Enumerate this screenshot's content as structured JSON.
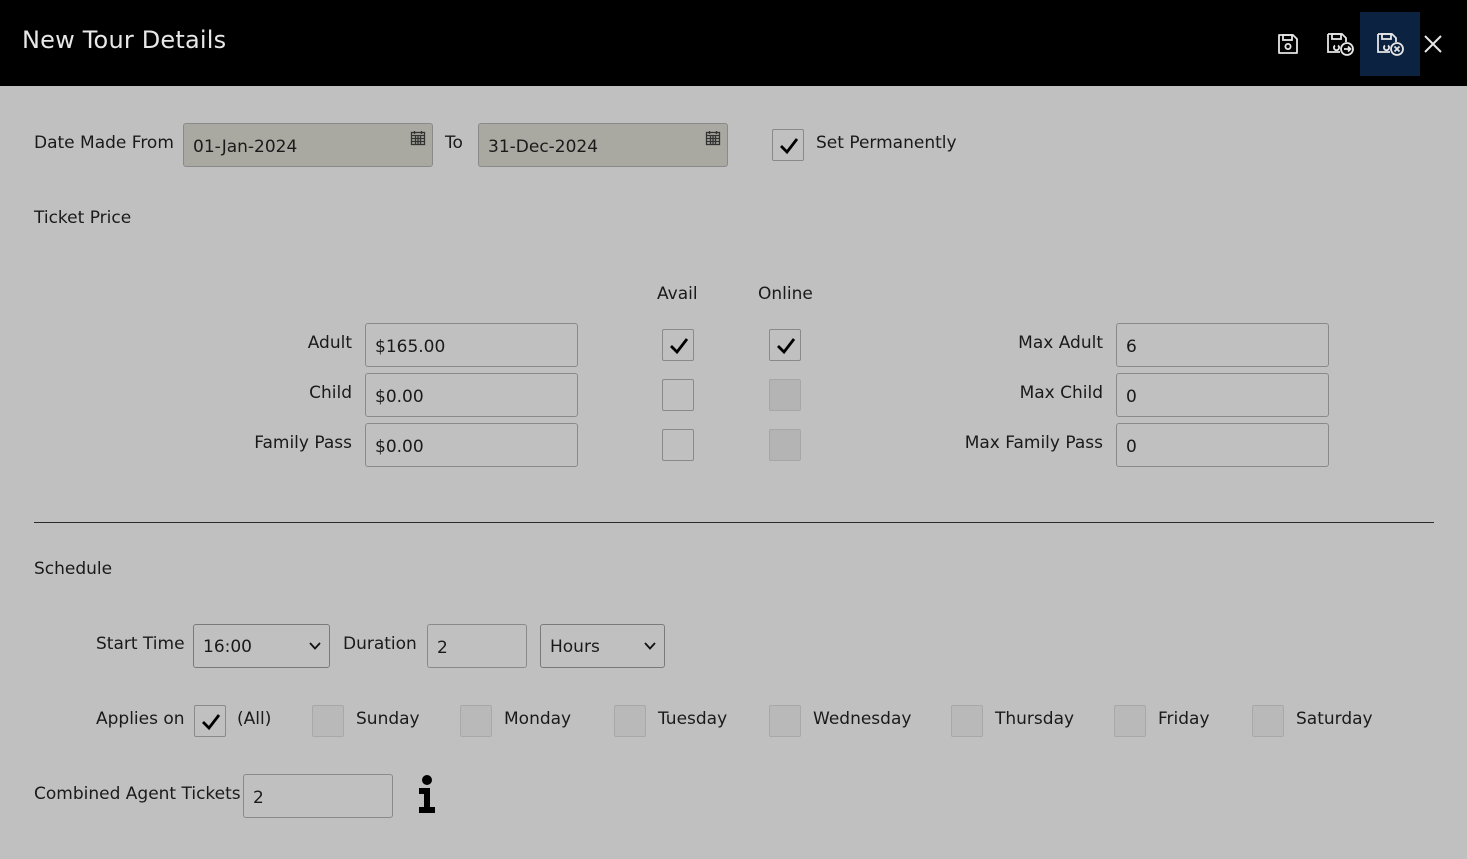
{
  "window": {
    "title": "New Tour Details"
  },
  "toolbar": {
    "save_icon": "save-icon",
    "save_new_icon": "save-and-new-icon",
    "save_close_icon": "save-and-close-icon",
    "close_icon": "close-icon"
  },
  "dates": {
    "from_label": "Date Made From",
    "from_value": "01-Jan-2024",
    "to_label": "To",
    "to_value": "31-Dec-2024",
    "set_permanently_label": "Set Permanently",
    "set_permanently_checked": true
  },
  "ticket_price": {
    "heading": "Ticket Price",
    "avail_header": "Avail",
    "online_header": "Online",
    "rows": [
      {
        "label": "Adult",
        "price": "$165.00",
        "avail": true,
        "online": true,
        "max_label": "Max Adult",
        "max_value": "6"
      },
      {
        "label": "Child",
        "price": "$0.00",
        "avail": false,
        "online": false,
        "max_label": "Max Child",
        "max_value": "0"
      },
      {
        "label": "Family Pass",
        "price": "$0.00",
        "avail": false,
        "online": false,
        "max_label": "Max Family Pass",
        "max_value": "0"
      }
    ]
  },
  "schedule": {
    "heading": "Schedule",
    "start_time_label": "Start Time",
    "start_time_value": "16:00",
    "duration_label": "Duration",
    "duration_value": "2",
    "duration_unit": "Hours",
    "applies_on_label": "Applies on",
    "days": [
      {
        "label": "(All)",
        "checked": true
      },
      {
        "label": "Sunday",
        "checked": false
      },
      {
        "label": "Monday",
        "checked": false
      },
      {
        "label": "Tuesday",
        "checked": false
      },
      {
        "label": "Wednesday",
        "checked": false
      },
      {
        "label": "Thursday",
        "checked": false
      },
      {
        "label": "Friday",
        "checked": false
      },
      {
        "label": "Saturday",
        "checked": false
      }
    ]
  },
  "agent": {
    "combined_label": "Combined Agent Tickets",
    "combined_value": "2",
    "info_icon": "info-icon"
  },
  "colors": {
    "topbar": "#000000",
    "background": "#c0c0c0",
    "active_button": "#0b2340",
    "date_field": "#a9a9a1"
  }
}
